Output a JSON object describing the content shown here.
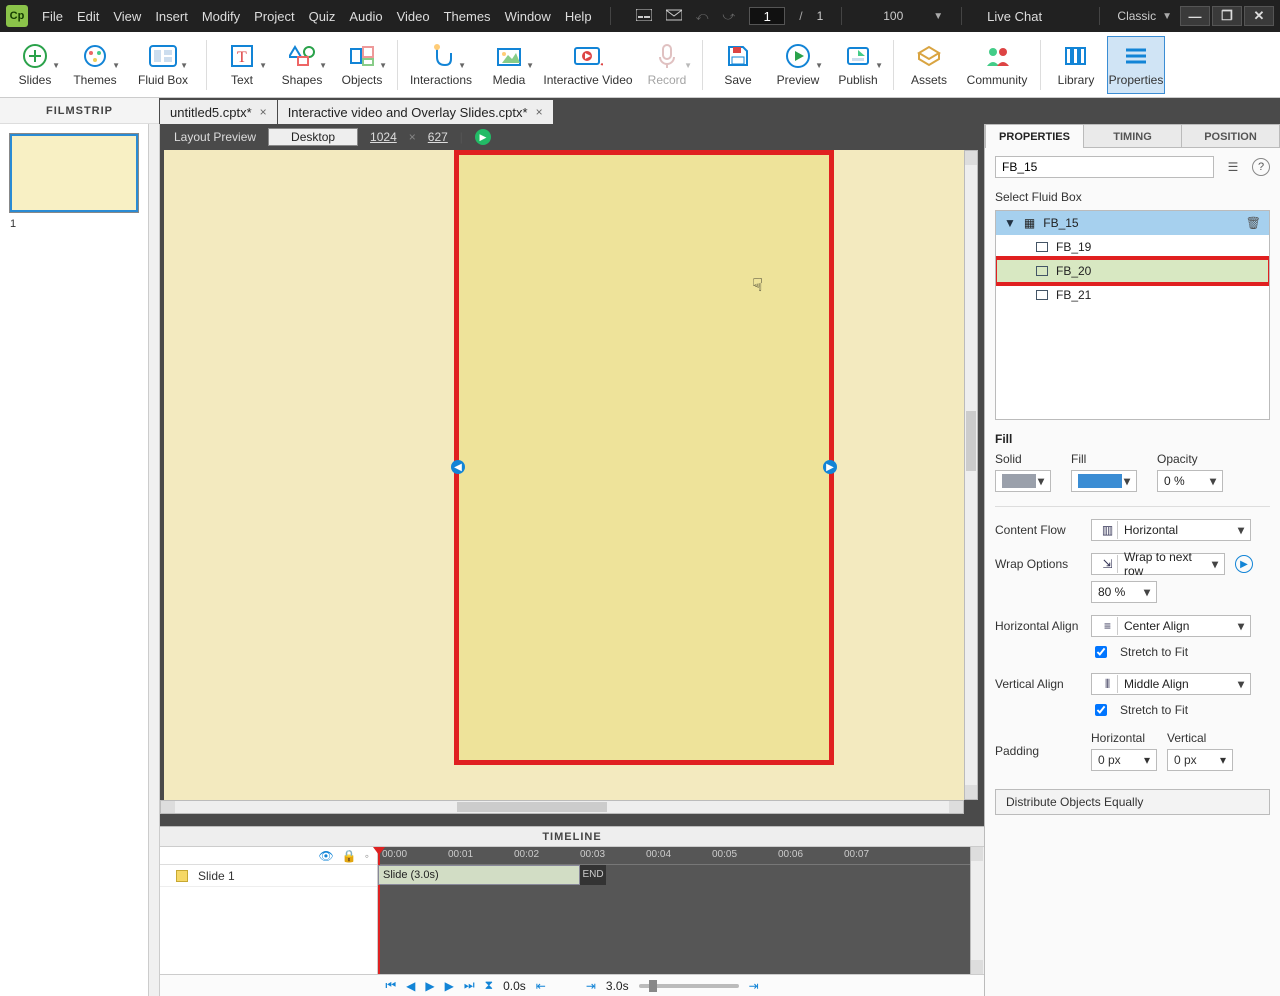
{
  "menu": {
    "items": [
      "File",
      "Edit",
      "View",
      "Insert",
      "Modify",
      "Project",
      "Quiz",
      "Audio",
      "Video",
      "Themes",
      "Window",
      "Help"
    ],
    "page_current": "1",
    "page_total": "1",
    "zoom": "100",
    "live_chat": "Live Chat",
    "workspace": "Classic"
  },
  "ribbon": [
    {
      "label": "Slides"
    },
    {
      "label": "Themes"
    },
    {
      "label": "Fluid Box"
    },
    {
      "label": "Text"
    },
    {
      "label": "Shapes"
    },
    {
      "label": "Objects"
    },
    {
      "label": "Interactions"
    },
    {
      "label": "Media"
    },
    {
      "label": "Interactive Video"
    },
    {
      "label": "Record"
    },
    {
      "label": "Save"
    },
    {
      "label": "Preview"
    },
    {
      "label": "Publish"
    },
    {
      "label": "Assets"
    },
    {
      "label": "Community"
    },
    {
      "label": "Library"
    },
    {
      "label": "Properties"
    }
  ],
  "tabs": [
    {
      "title": "untitled5.cptx*"
    },
    {
      "title": "Interactive video and Overlay Slides.cptx*"
    }
  ],
  "filmstrip": {
    "title": "FILMSTRIP",
    "items": [
      {
        "num": "1"
      }
    ]
  },
  "preview_bar": {
    "label": "Layout Preview",
    "device": "Desktop",
    "w": "1024",
    "h": "627"
  },
  "timeline": {
    "title": "TIMELINE",
    "tracks": [
      {
        "name": "Slide 1"
      }
    ],
    "clip": "Slide (3.0s)",
    "end": "END",
    "ticks": [
      "00:00",
      "00:01",
      "00:02",
      "00:03",
      "00:04",
      "00:05",
      "00:06",
      "00:07"
    ],
    "footer": {
      "t0": "0.0s",
      "t1": "3.0s"
    }
  },
  "props": {
    "tabs": [
      "PROPERTIES",
      "TIMING",
      "POSITION"
    ],
    "name": "FB_15",
    "select_label": "Select Fluid Box",
    "tree": {
      "root": "FB_15",
      "children": [
        "FB_19",
        "FB_20",
        "FB_21"
      ],
      "selected": "FB_20"
    },
    "fill": {
      "title": "Fill",
      "solid_label": "Solid",
      "fill_label": "Fill",
      "opacity_label": "Opacity",
      "opacity": "0 %"
    },
    "flow": {
      "content_flow_label": "Content Flow",
      "content_flow": "Horizontal",
      "wrap_label": "Wrap Options",
      "wrap": "Wrap to next row",
      "wrap_pct": "80 %",
      "halign_label": "Horizontal Align",
      "halign": "Center Align",
      "stretch_h": "Stretch to Fit",
      "valign_label": "Vertical Align",
      "valign": "Middle Align",
      "stretch_v": "Stretch to Fit",
      "padding_label": "Padding",
      "pad_h_label": "Horizontal",
      "pad_v_label": "Vertical",
      "pad_h": "0 px",
      "pad_v": "0 px",
      "distribute": "Distribute Objects Equally"
    }
  }
}
